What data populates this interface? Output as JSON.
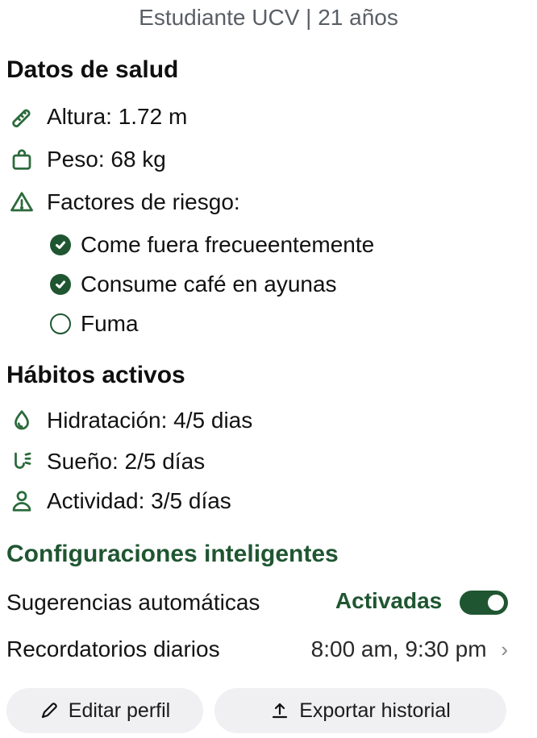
{
  "header": {
    "subtitle": "Estudiante UCV | 21 años"
  },
  "health": {
    "title": "Datos de salud",
    "height_label": "Altura: 1.72 m",
    "weight_label": "Peso: 68 kg",
    "risk_label": "Factores de riesgo:",
    "risks": [
      {
        "label": "Come fuera frecueentemente",
        "checked": true
      },
      {
        "label": "Consume café en ayunas",
        "checked": true
      },
      {
        "label": "Fuma",
        "checked": false
      }
    ]
  },
  "habits": {
    "title": "Hábitos activos",
    "items": [
      {
        "label": "Hidratación:  4/5 dias",
        "icon": "hydration-icon"
      },
      {
        "label": "Sueño: 2/5 días",
        "icon": "sleep-icon"
      },
      {
        "label": "Actividad: 3/5 días",
        "icon": "activity-icon"
      }
    ]
  },
  "smart_settings": {
    "title": "Configuraciones inteligentes",
    "suggestions_label": "Sugerencias automáticas",
    "suggestions_status": "Activadas",
    "suggestions_enabled": true,
    "reminders_label": "Recordatorios diarios",
    "reminders_value": "8:00 am, 9:30 pm"
  },
  "actions": {
    "edit_label": "Editar perfil",
    "export_label": "Exportar historial"
  },
  "colors": {
    "accent": "#1f5631",
    "muted_text": "#5a5f66",
    "button_bg": "#f0f0f2"
  }
}
